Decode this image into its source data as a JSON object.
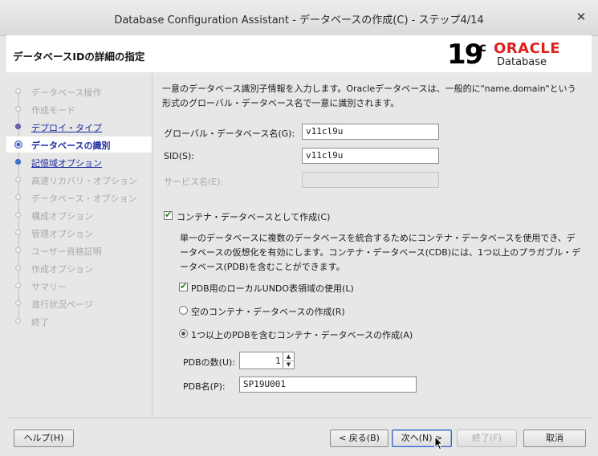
{
  "window": {
    "title": "Database Configuration Assistant - データベースの作成(C) - ステップ4/14"
  },
  "header": {
    "page_title": "データベースIDの詳細の指定",
    "logo_number": "19",
    "logo_superscript": "c",
    "logo_brand": "ORACLE",
    "logo_product": "Database",
    "brand_color": "#e0201c"
  },
  "nav": {
    "items": [
      {
        "label": "データベース操作",
        "state": "disabled"
      },
      {
        "label": "作成モード",
        "state": "disabled"
      },
      {
        "label": "デプロイ・タイプ",
        "state": "done"
      },
      {
        "label": "データベースの識別",
        "state": "current"
      },
      {
        "label": "記憶域オプション",
        "state": "next"
      },
      {
        "label": "高速リカバリ・オプション",
        "state": "disabled"
      },
      {
        "label": "データベース・オプション",
        "state": "disabled"
      },
      {
        "label": "構成オプション",
        "state": "disabled"
      },
      {
        "label": "管理オプション",
        "state": "disabled"
      },
      {
        "label": "ユーザー資格証明",
        "state": "disabled"
      },
      {
        "label": "作成オプション",
        "state": "disabled"
      },
      {
        "label": "サマリー",
        "state": "disabled"
      },
      {
        "label": "進行状況ページ",
        "state": "disabled"
      },
      {
        "label": "終了",
        "state": "disabled"
      }
    ]
  },
  "content": {
    "description": "一意のデータベース識別子情報を入力します。Oracleデータベースは、一般的に\"name.domain\"という形式のグローバル・データベース名で一意に識別されます。",
    "global_db_name_label": "グローバル・データベース名(G):",
    "global_db_name_value": "v11cl9u",
    "sid_label": "SID(S):",
    "sid_value": "v11cl9u",
    "service_name_label": "サービス名(E):",
    "service_name_value": "",
    "container_checkbox_label": "コンテナ・データベースとして作成(C)",
    "container_checked": true,
    "container_description": "単一のデータベースに複数のデータベースを統合するためにコンテナ・データベースを使用でき、データベースの仮想化を有効にします。コンテナ・データベース(CDB)には、1つ以上のプラガブル・データベース(PDB)を含むことができます。",
    "local_undo_label": "PDB用のローカルUNDO表領域の使用(L)",
    "local_undo_checked": true,
    "empty_cdb_label": "空のコンテナ・データベースの作成(R)",
    "with_pdb_label": "1つ以上のPDBを含むコンテナ・データベースの作成(A)",
    "selected_option": "with_pdb",
    "pdb_count_label": "PDBの数(U):",
    "pdb_count_value": "1",
    "pdb_name_label": "PDB名(P):",
    "pdb_name_value": "SP19U001"
  },
  "footer": {
    "help_label": "ヘルプ(H)",
    "back_label": "< 戻る(B)",
    "next_label": "次へ(N) >",
    "finish_label": "終了(F)",
    "cancel_label": "取消"
  }
}
